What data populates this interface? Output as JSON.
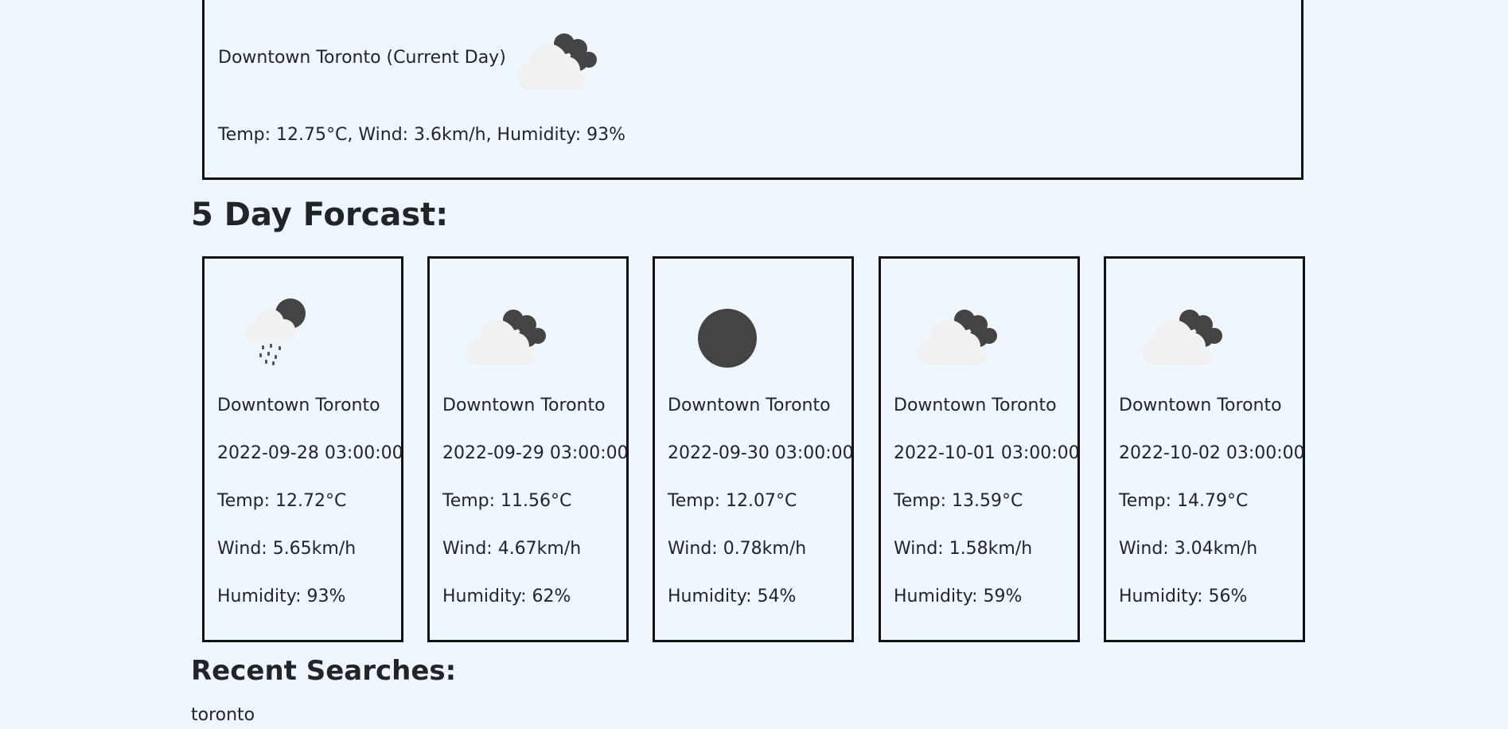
{
  "current": {
    "title": "Downtown Toronto (Current Day)",
    "icon": "partly-cloudy-night-icon",
    "stats": "Temp: 12.75°C, Wind: 3.6km/h, Humidity: 93%"
  },
  "forecast": {
    "heading": "5 Day Forcast:",
    "days": [
      {
        "icon": "rain-night-icon",
        "city": "Downtown Toronto",
        "date": "2022-09-28 03:00:00",
        "temp": "Temp: 12.72°C",
        "wind": "Wind: 5.65km/h",
        "humidity": "Humidity: 93%"
      },
      {
        "icon": "partly-cloudy-night-icon",
        "city": "Downtown Toronto",
        "date": "2022-09-29 03:00:00",
        "temp": "Temp: 11.56°C",
        "wind": "Wind: 4.67km/h",
        "humidity": "Humidity: 62%"
      },
      {
        "icon": "clear-night-icon",
        "city": "Downtown Toronto",
        "date": "2022-09-30 03:00:00",
        "temp": "Temp: 12.07°C",
        "wind": "Wind: 0.78km/h",
        "humidity": "Humidity: 54%"
      },
      {
        "icon": "partly-cloudy-night-icon",
        "city": "Downtown Toronto",
        "date": "2022-10-01 03:00:00",
        "temp": "Temp: 13.59°C",
        "wind": "Wind: 1.58km/h",
        "humidity": "Humidity: 59%"
      },
      {
        "icon": "partly-cloudy-night-icon",
        "city": "Downtown Toronto",
        "date": "2022-10-02 03:00:00",
        "temp": "Temp: 14.79°C",
        "wind": "Wind: 3.04km/h",
        "humidity": "Humidity: 56%"
      }
    ]
  },
  "recent": {
    "heading": "Recent Searches:",
    "items": [
      "toronto"
    ]
  },
  "colors": {
    "background": "#eff7fe",
    "border": "#111111",
    "text": "#212529",
    "cloud_light": "#f1f1f1",
    "cloud_dark": "#444444"
  }
}
